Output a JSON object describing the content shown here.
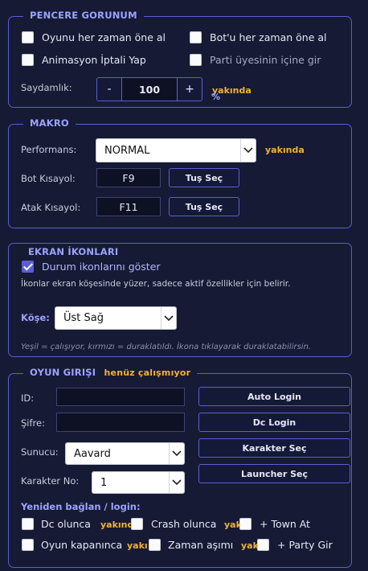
{
  "window_section": {
    "title": "PENCERE GORUNUM",
    "always_on_top": "Oyunu her zaman öne al",
    "bot_always_on_top": "Bot'u her zaman öne al",
    "animation_cancel": "Animasyon İptali Yap",
    "party_enter": "Parti üyesinin içine gir",
    "opacity_label": "Saydamlık:",
    "opacity_value": "100",
    "minus": "-",
    "plus": "+",
    "soon": "yakında",
    "percent": "%"
  },
  "macro_section": {
    "title": "MAKRO",
    "performance_label": "Performans:",
    "performance_value": "NORMAL",
    "soon": "yakında",
    "bot_shortcut_label": "Bot Kısayol:",
    "bot_shortcut_value": "F9",
    "attack_shortcut_label": "Atak Kısayol:",
    "attack_shortcut_value": "F11",
    "key_select": "Tuş Seç"
  },
  "icons_section": {
    "title": "EKRAN İKONLARI",
    "show_status": "Durum ikonlarını göster",
    "description": "İkonlar ekran köşesinde yüzer, sadece aktif özellikler için belirir.",
    "corner_label": "Köşe:",
    "corner_value": "Üst Sağ",
    "hint": "Yeşil = çalışıyor, kırmızı = duraklatıldı. İkona tıklayarak duraklatabilirsin."
  },
  "login_section": {
    "title": "OYUN GIRIŞI",
    "not_working": "henüz çalışmıyor",
    "id_label": "ID:",
    "id_value": "",
    "password_label": "Şifre:",
    "password_value": "",
    "server_label": "Sunucu:",
    "server_value": "Aavard",
    "char_no_label": "Karakter No:",
    "char_no_value": "1",
    "auto_login": "Auto Login",
    "dc_login": "Dc Login",
    "char_select": "Karakter Seç",
    "launcher_select": "Launcher Seç",
    "reconnect_title": "Yeniden bağlan / login:",
    "dc_when": "Dc olunca",
    "soon_dc": "yakınd",
    "crash_when": "Crash olunca",
    "soon_crash": "yak",
    "town_at": "+ Town At",
    "game_close": "Oyun kapanınca",
    "soon_game": "yakı",
    "timeout": "Zaman aşımı",
    "soon_timeout": "yak",
    "party_join": "+ Party Gir"
  }
}
